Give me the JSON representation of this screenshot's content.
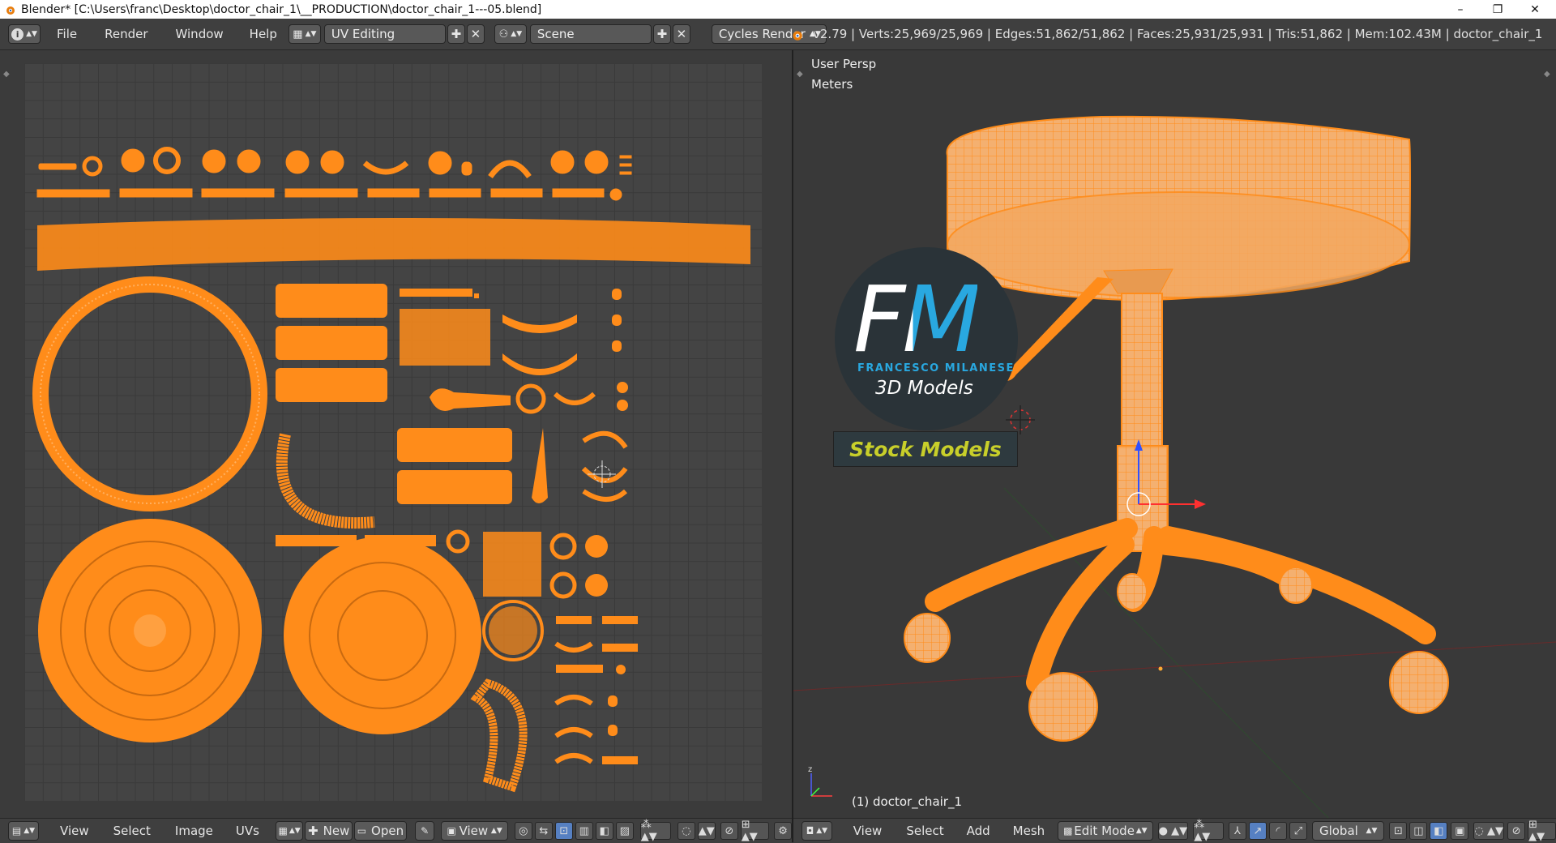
{
  "window": {
    "title": "Blender* [C:\\Users\\franc\\Desktop\\doctor_chair_1\\__PRODUCTION\\doctor_chair_1---05.blend]",
    "minimize": "–",
    "maximize": "❐",
    "close": "✕"
  },
  "topbar": {
    "info_icon": "i",
    "menus": [
      "File",
      "Render",
      "Window",
      "Help"
    ],
    "screen_layout": "UV Editing",
    "scene": "Scene",
    "render_engine": "Cycles Render",
    "stats": "v2.79 | Verts:25,969/25,969 | Edges:51,862/51,862 | Faces:25,931/25,931 | Tris:51,862 | Mem:102.43M | doctor_chair_1"
  },
  "viewport": {
    "view_name": "User Persp",
    "units": "Meters",
    "object_label": "(1) doctor_chair_1",
    "watermark": {
      "letters": "FM",
      "name": "FRANCESCO MILANESE",
      "subtitle": "3D Models",
      "badge": "Stock Models"
    }
  },
  "uv_header": {
    "menus": [
      "View",
      "Select",
      "Image",
      "UVs"
    ],
    "new_label": "New",
    "open_label": "Open",
    "view_label": "View"
  },
  "view3d_header": {
    "menus": [
      "View",
      "Select",
      "Add",
      "Mesh"
    ],
    "mode": "Edit Mode",
    "orientation": "Global"
  },
  "colors": {
    "mesh_orange": "#ff8c1a",
    "header_bg": "#3f3f3f",
    "logo_blue": "#29a8e0",
    "badge_yellow": "#c8cf2a"
  }
}
